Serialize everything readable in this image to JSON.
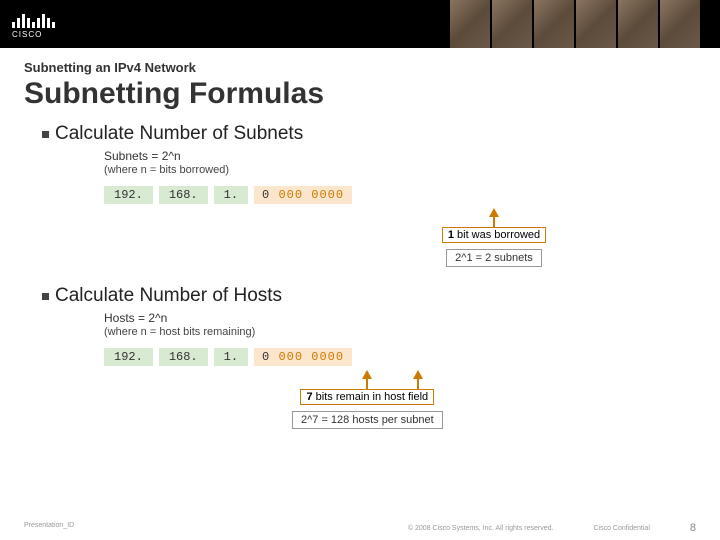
{
  "header": {
    "logo_text": "CISCO"
  },
  "pretitle": "Subnetting an IPv4 Network",
  "title": "Subnetting Formulas",
  "section1": {
    "bullet": "Calculate Number of Subnets",
    "formula_main": "Subnets = 2^n",
    "formula_sub": "(where n = bits borrowed)",
    "octet1": "192.",
    "octet2": "168.",
    "octet3": "1.",
    "last_net": "0",
    "last_host": "000 0000",
    "annotation_num": "1",
    "annotation_text": " bit was borrowed",
    "result": "2^1 = 2 subnets"
  },
  "section2": {
    "bullet": "Calculate Number of Hosts",
    "formula_main": "Hosts = 2^n",
    "formula_sub": "(where n = host bits remaining)",
    "octet1": "192.",
    "octet2": "168.",
    "octet3": "1.",
    "last_net": "0",
    "last_host": "000 0000",
    "annotation_num": "7",
    "annotation_text": " bits remain in host field",
    "result": "2^7 = 128 hosts per subnet"
  },
  "footer": {
    "left": "Presentation_ID",
    "center": "© 2008 Cisco Systems, Inc. All rights reserved.",
    "right": "Cisco Confidential",
    "page": "8"
  }
}
